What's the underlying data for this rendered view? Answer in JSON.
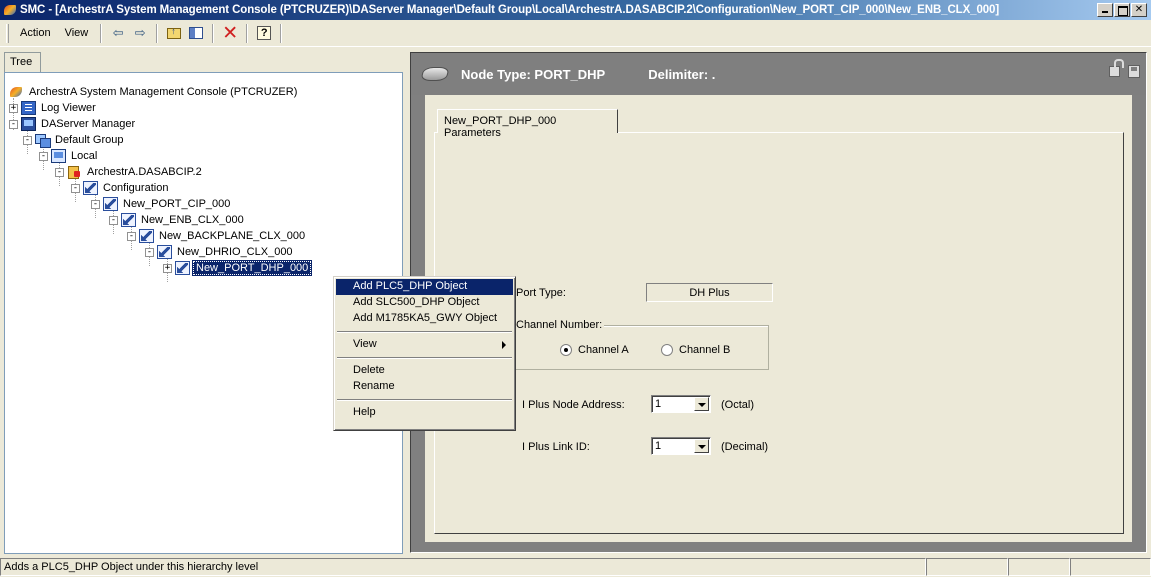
{
  "window": {
    "title": "SMC - [ArchestrA System Management Console (PTCRUZER)\\DAServer Manager\\Default Group\\Local\\ArchestrA.DASABCIP.2\\Configuration\\New_PORT_CIP_000\\New_ENB_CLX_000]",
    "icon": "archestra-icon"
  },
  "menu": {
    "action": "Action",
    "view": "View"
  },
  "toolbar": {
    "icons": [
      "back-arrow-icon",
      "forward-arrow-icon",
      "up-folder-icon",
      "show-hide-tree-icon",
      "delete-icon",
      "help-icon"
    ]
  },
  "left": {
    "tab_label": "Tree",
    "nodes": [
      {
        "label": "ArchestrA System Management Console (PTCRUZER)",
        "icon": "archestra-icon"
      },
      {
        "label": "Log Viewer",
        "icon": "log-viewer-icon"
      },
      {
        "label": "DAServer Manager",
        "icon": "daserver-manager-icon"
      },
      {
        "label": "Default Group",
        "icon": "group-icon"
      },
      {
        "label": "Local",
        "icon": "computer-icon"
      },
      {
        "label": "ArchestrA.DASABCIP.2",
        "icon": "daserver-icon"
      },
      {
        "label": "Configuration",
        "icon": "configuration-icon"
      },
      {
        "label": "New_PORT_CIP_000",
        "icon": "port-icon"
      },
      {
        "label": "New_ENB_CLX_000",
        "icon": "port-icon"
      },
      {
        "label": "New_BACKPLANE_CLX_000",
        "icon": "port-icon"
      },
      {
        "label": "New_DHRIO_CLX_000",
        "icon": "port-icon"
      },
      {
        "label": "New_PORT_DHP_000",
        "icon": "port-icon",
        "selected": true
      }
    ]
  },
  "context_menu": {
    "items": [
      {
        "label": "Add PLC5_DHP Object",
        "highlighted": true
      },
      {
        "label": "Add SLC500_DHP Object"
      },
      {
        "label": "Add M1785KA5_GWY Object"
      },
      {
        "label": "View",
        "submenu": true
      },
      {
        "label": "Delete"
      },
      {
        "label": "Rename"
      },
      {
        "label": "Help"
      }
    ]
  },
  "right": {
    "header": {
      "node_type": "Node Type: PORT_DHP",
      "delimiter": "Delimiter: ."
    },
    "tab_label": "New_PORT_DHP_000 Parameters",
    "port_type_label": "Port Type:",
    "port_type_value": "DH Plus",
    "channel_group_title": "Channel Number:",
    "channel_a": "Channel A",
    "channel_b": "Channel B",
    "channel_selected": "Channel A",
    "node_address_label": "I Plus Node Address:",
    "node_address_value": "1",
    "node_address_unit": "(Octal)",
    "link_id_label": "I Plus Link ID:",
    "link_id_value": "1",
    "link_id_unit": "(Decimal)"
  },
  "status": {
    "text": "Adds a PLC5_DHP Object under this hierarchy level"
  }
}
